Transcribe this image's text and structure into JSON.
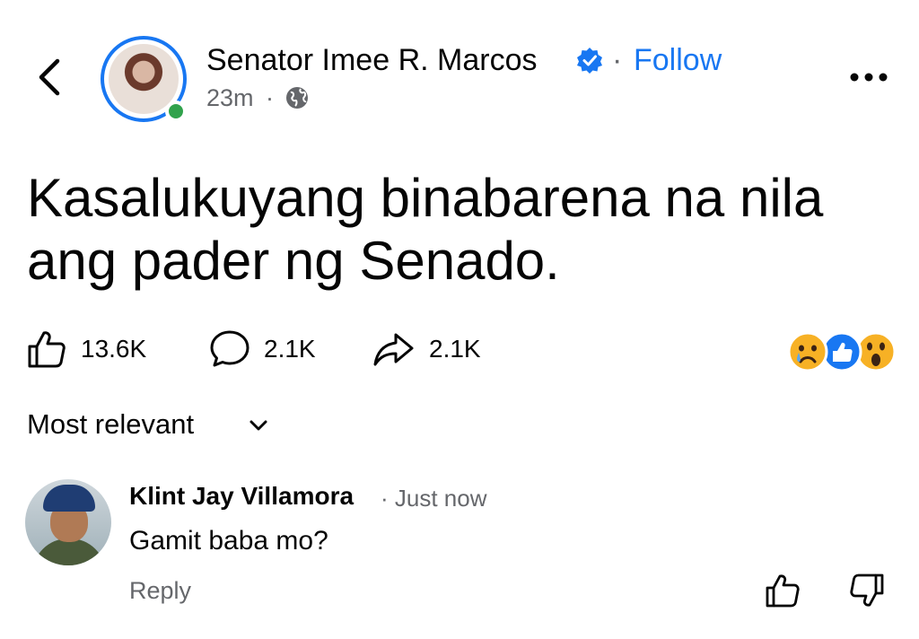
{
  "header": {
    "author_name": "Senator Imee R. Marcos",
    "separator": "·",
    "follow_label": "Follow",
    "timestamp": "23m",
    "time_separator": "·"
  },
  "post": {
    "text": "Kasalukuyang binabarena na nila ang pader ng Senado."
  },
  "stats": {
    "likes": "13.6K",
    "comments": "2.1K",
    "shares": "2.1K",
    "reactions": [
      "sad-reaction",
      "like-reaction",
      "wow-reaction"
    ]
  },
  "comments_section": {
    "sort_label": "Most relevant"
  },
  "comment": {
    "author": "Klint Jay Villamora",
    "time": "· Just now",
    "text": "Gamit baba mo?",
    "reply_label": "Reply"
  },
  "colors": {
    "accent": "#1877f2",
    "online": "#31a24c",
    "secondary_text": "#65676b"
  }
}
